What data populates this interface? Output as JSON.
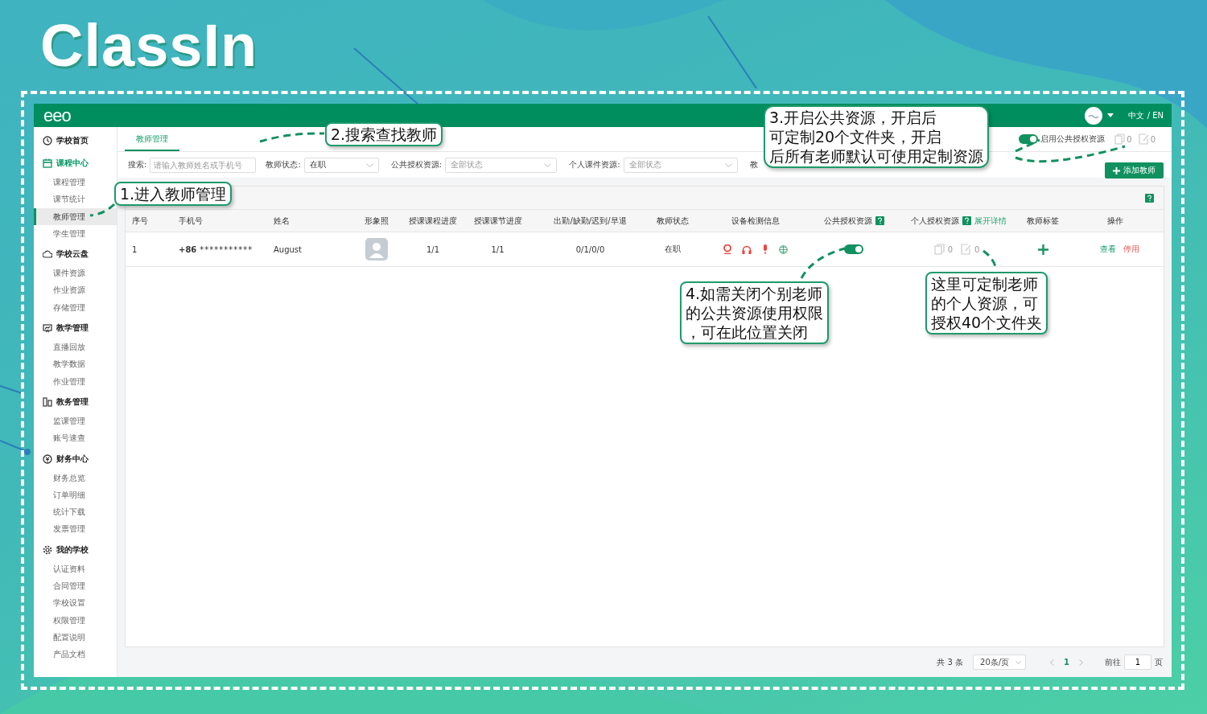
{
  "brand": {
    "logo": "ClassIn"
  },
  "app": {
    "logo": "eeo",
    "language": "中文 / EN"
  },
  "sidebar": {
    "groups": [
      {
        "kind": "clock",
        "label": "学校首页",
        "active": false
      },
      {
        "kind": "calendar",
        "label": "课程中心",
        "active": true,
        "children": [
          {
            "label": "课程管理",
            "selected": false
          },
          {
            "label": "课节统计",
            "selected": false
          },
          {
            "label": "教师管理",
            "selected": true
          },
          {
            "label": "学生管理",
            "selected": false
          }
        ]
      },
      {
        "kind": "cloud",
        "label": "学校云盘",
        "active": false,
        "children": [
          {
            "label": "课件资源",
            "selected": false
          },
          {
            "label": "作业资源",
            "selected": false
          },
          {
            "label": "存储管理",
            "selected": false
          }
        ]
      },
      {
        "kind": "board",
        "label": "教学管理",
        "active": false,
        "children": [
          {
            "label": "直播回放",
            "selected": false
          },
          {
            "label": "教学数据",
            "selected": false
          },
          {
            "label": "作业管理",
            "selected": false
          }
        ]
      },
      {
        "kind": "book",
        "label": "教务管理",
        "active": false,
        "children": [
          {
            "label": "监课管理",
            "selected": false
          },
          {
            "label": "账号速查",
            "selected": false
          }
        ]
      },
      {
        "kind": "money",
        "label": "财务中心",
        "active": false,
        "children": [
          {
            "label": "财务总览",
            "selected": false
          },
          {
            "label": "订单明细",
            "selected": false
          },
          {
            "label": "统计下载",
            "selected": false
          },
          {
            "label": "发票管理",
            "selected": false
          }
        ]
      },
      {
        "kind": "gear",
        "label": "我的学校",
        "active": false,
        "children": [
          {
            "label": "认证资料",
            "selected": false
          },
          {
            "label": "合同管理",
            "selected": false
          },
          {
            "label": "学校设置",
            "selected": false
          },
          {
            "label": "权限管理",
            "selected": false
          },
          {
            "label": "配置说明",
            "selected": false
          },
          {
            "label": "产品文档",
            "selected": false
          }
        ]
      }
    ]
  },
  "tabs": [
    {
      "label": "教师管理",
      "selected": true
    }
  ],
  "public_toggle": {
    "label": "启用公共授权资源",
    "on": true,
    "copy_count": "0",
    "edit_count": "0"
  },
  "filters": [
    {
      "kind": "input",
      "label": "搜索:",
      "placeholder": "请输入教师姓名或手机号"
    },
    {
      "kind": "select",
      "label": "教师状态:",
      "value": "在职"
    },
    {
      "kind": "select",
      "label": "公共授权资源:",
      "placeholder": "全部状态"
    },
    {
      "kind": "select",
      "label": "个人课件资源:",
      "placeholder": "全部状态"
    },
    {
      "kind": "label",
      "label": "教"
    }
  ],
  "add_button": "添加教师",
  "table": {
    "columns": [
      {
        "label": "序号",
        "help": false
      },
      {
        "label": "手机号",
        "help": false
      },
      {
        "label": "姓名",
        "help": false
      },
      {
        "label": "形象照",
        "help": false
      },
      {
        "label": "授课课程进度",
        "help": false
      },
      {
        "label": "授课课节进度",
        "help": false
      },
      {
        "label": "出勤/缺勤/迟到/早退",
        "help": false
      },
      {
        "label": "教师状态",
        "help": false
      },
      {
        "label": "设备检测信息",
        "help": false
      },
      {
        "label": "公共授权资源",
        "help": true
      },
      {
        "label": "个人授权资源",
        "help": true,
        "link": "展开详情"
      },
      {
        "label": "教师标签",
        "help": false
      },
      {
        "label": "操作",
        "help": false
      }
    ],
    "rows": [
      {
        "index": "1",
        "phone_prefix": "+86",
        "phone": "***********",
        "name": "August",
        "course_progress": "1/1",
        "lesson_progress": "1/1",
        "attendance": "0/1/0/0",
        "status": "在职",
        "public_resource_on": true,
        "copy_count": "0",
        "edit_count": "0",
        "actions": [
          {
            "kind": "view",
            "label": "查看"
          },
          {
            "kind": "disable",
            "label": "停用"
          }
        ]
      }
    ]
  },
  "pagination": {
    "total": "共 3 条",
    "page_size": "20条/页",
    "pages": [
      {
        "label": "1",
        "selected": true
      }
    ],
    "goto_label": "前往",
    "goto_value": "1",
    "goto_unit": "页"
  },
  "callouts": [
    {
      "lines": [
        "1.进入教师管理"
      ]
    },
    {
      "lines": [
        "2.搜索查找教师"
      ]
    },
    {
      "lines": [
        "3.开启公共资源，开启后",
        "可定制20个文件夹，开启",
        "后所有老师默认可使用定制资源"
      ]
    },
    {
      "lines": [
        "4.如需关闭个别老师",
        "的公共资源使用权限",
        "，可在此位置关闭"
      ]
    },
    {
      "lines": [
        "这里可定制老师",
        "的个人资源，可",
        "授权40个文件夹"
      ]
    }
  ]
}
